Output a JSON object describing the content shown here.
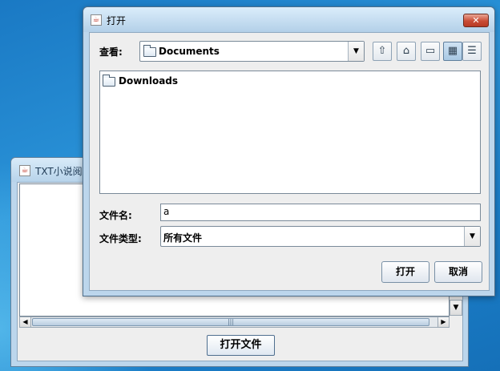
{
  "back_window": {
    "title": "TXT小说阅读",
    "open_file_button": "打开文件",
    "scroll_thumb_grip": "|||"
  },
  "dialog": {
    "title": "打开",
    "close_icon": "✕",
    "look_in_label": "查看:",
    "look_in_value": "Documents",
    "files": [
      "Downloads"
    ],
    "filename_label": "文件名:",
    "filename_value": "a",
    "filetype_label": "文件类型:",
    "filetype_value": "所有文件",
    "open_button": "打开",
    "cancel_button": "取消"
  },
  "icons": {
    "app_icon": "java-app-icon",
    "up_folder": "up-one-level-icon",
    "home": "home-icon",
    "new_folder": "new-folder-icon",
    "list_view": "list-view-icon",
    "details_view": "details-view-icon"
  },
  "colors": {
    "desktop": "#1a79c4",
    "close_button": "#c94c35",
    "titlebar": "#bcd6ec"
  }
}
